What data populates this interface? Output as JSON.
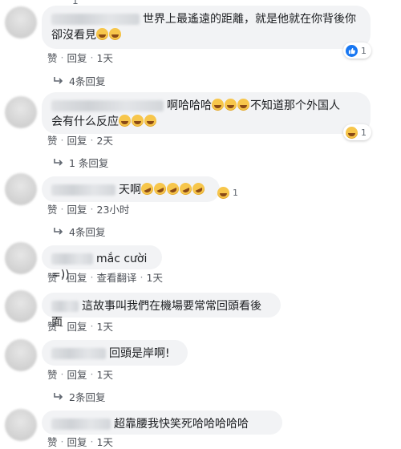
{
  "top_fragment": "1",
  "comments": [
    {
      "text_line1": "世界上最遙遠的距離，就是他就在你背後你",
      "text_line2": "卻沒看見",
      "meta": {
        "like": "赞",
        "reply": "回复",
        "time": "1天"
      },
      "reaction": {
        "icon": "like-icon",
        "count": "1"
      },
      "replies": "4条回复"
    },
    {
      "text_line1": "啊哈哈哈",
      "text_line1b": "不知道那个外国人",
      "text_line2": "会有什么反应",
      "meta": {
        "like": "赞",
        "reply": "回复",
        "time": "2天"
      },
      "reaction": {
        "icon": "haha-icon",
        "count": "1"
      },
      "replies": "1 条回复"
    },
    {
      "text": "天啊",
      "meta": {
        "like": "赞",
        "reply": "回复",
        "time": "23小时"
      },
      "reaction": {
        "icon": "haha-icon",
        "count": "1"
      },
      "replies": "4条回复"
    },
    {
      "text": "mắc cười =))",
      "meta": {
        "like": "赞",
        "reply": "回复",
        "translate": "查看翻译",
        "time": "1天"
      }
    },
    {
      "text": "這故事叫我們在機場要常常回頭看後面",
      "meta": {
        "like": "赞",
        "reply": "回复",
        "time": "1天"
      }
    },
    {
      "text": "回頭是岸啊!",
      "meta": {
        "like": "赞",
        "reply": "回复",
        "time": "1天"
      },
      "replies": "2条回复"
    },
    {
      "text": "超靠腰我快笑死哈哈哈哈哈",
      "meta": {
        "like": "赞",
        "reply": "回复",
        "time": "1天"
      }
    }
  ],
  "colors": {
    "bubble": "#f2f3f5",
    "meta": "#606770",
    "like_blue": "#1877f2",
    "emoji": "#f7c64b"
  }
}
